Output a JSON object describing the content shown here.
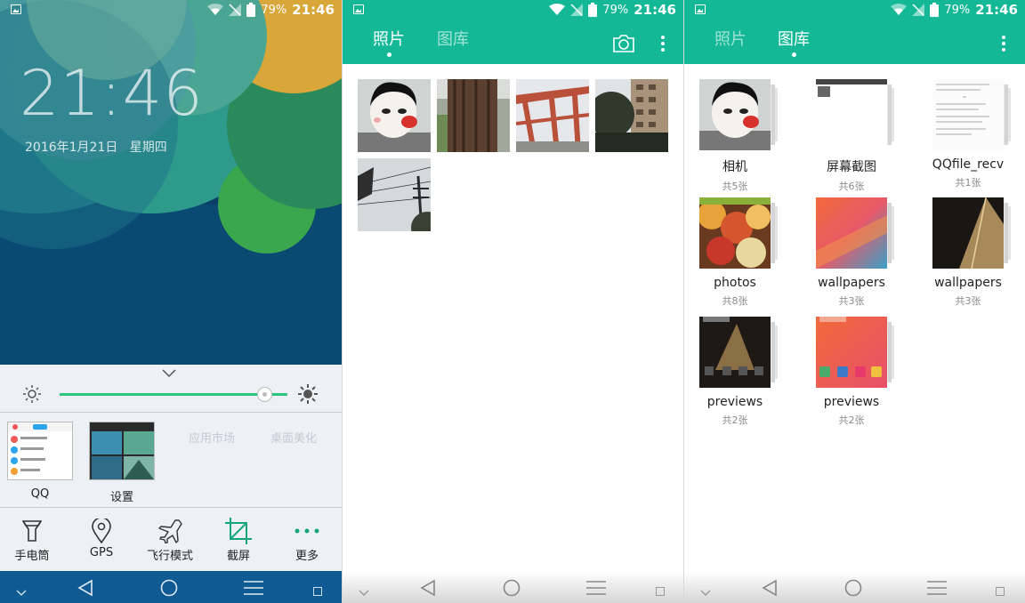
{
  "lockscreen": {
    "status": {
      "battery": "79%",
      "time": "21:46"
    },
    "clock": "21:46",
    "date": "2016年1月21日",
    "weekday": "星期四",
    "shade": {
      "recent_apps": [
        {
          "label": "QQ"
        },
        {
          "label": "设置"
        }
      ],
      "background_labels": [
        "应用市场",
        "桌面美化"
      ],
      "quick_settings": [
        {
          "label": "手电筒",
          "icon": "flashlight-icon"
        },
        {
          "label": "GPS",
          "icon": "location-pin-icon"
        },
        {
          "label": "飞行模式",
          "icon": "airplane-icon"
        },
        {
          "label": "截屏",
          "icon": "crop-icon"
        },
        {
          "label": "更多",
          "icon": "more-dots-icon"
        }
      ],
      "brightness": 0.9
    }
  },
  "photos_screen": {
    "status": {
      "battery": "79%",
      "time": "21:46"
    },
    "tabs": [
      "照片",
      "图库"
    ],
    "active_tab": "照片",
    "photo_count": 5
  },
  "gallery_screen": {
    "status": {
      "battery": "79%",
      "time": "21:46"
    },
    "tabs": [
      "照片",
      "图库"
    ],
    "active_tab": "图库",
    "albums": [
      {
        "name": "相机",
        "count": "共5张"
      },
      {
        "name": "屏幕截图",
        "count": "共6张"
      },
      {
        "name": "QQfile_recv",
        "count": "共1张"
      },
      {
        "name": "photos",
        "count": "共8张"
      },
      {
        "name": "wallpapers",
        "count": "共3张"
      },
      {
        "name": "wallpapers",
        "count": "共3张"
      },
      {
        "name": "previews",
        "count": "共2张"
      },
      {
        "name": "previews",
        "count": "共2张"
      }
    ]
  },
  "colors": {
    "accent": "#14b897",
    "slider": "#2ec47b",
    "wallpaper_dark": "#0b3f6a",
    "navbar_dark": "#0f5a93"
  }
}
